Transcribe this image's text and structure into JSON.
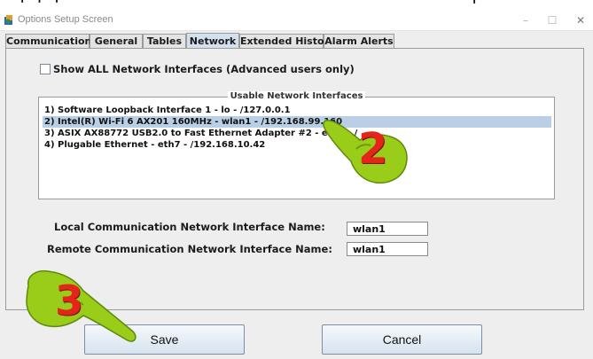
{
  "window": {
    "title": "Options Setup Screen",
    "controls": [
      "minimize-icon",
      "maximize-icon",
      "close-icon"
    ]
  },
  "tabs": [
    {
      "label": "Communications"
    },
    {
      "label": "General"
    },
    {
      "label": "Tables"
    },
    {
      "label": "Network",
      "active": true
    },
    {
      "label": "Extended History"
    },
    {
      "label": "Alarm Alerts"
    }
  ],
  "network": {
    "show_all_label": "Show ALL Network Interfaces (Advanced users only)",
    "show_all_checked": false,
    "interfaces_title": "Usable Network Interfaces",
    "interfaces": [
      "1) Software Loopback Interface 1  - lo - /127.0.0.1",
      "2) Intel(R) Wi-Fi 6 AX201 160MHz  - wlan1 - /192.168.99.160",
      "3) ASIX AX88772 USB2.0 to Fast Ethernet Adapter #2  - eth4 - /",
      "4) Plugable Ethernet  - eth7 - /192.168.10.42"
    ],
    "selected_index": 1,
    "local_label": "Local Communication Network Interface Name:",
    "local_value": "wlan1",
    "remote_label": "Remote Communication Network Interface Name:",
    "remote_value": "wlan1"
  },
  "buttons": {
    "save": "Save",
    "cancel": "Cancel"
  },
  "annotations": {
    "step2": "2",
    "step3": "3",
    "hand_color": "#9acd1a"
  },
  "colors": {
    "selection": "#b8cfe5",
    "active_tab": "#d3e0ee",
    "button_top": "#f4f8fc",
    "button_bottom": "#d7e3ef",
    "step_number": "#e5241a"
  }
}
